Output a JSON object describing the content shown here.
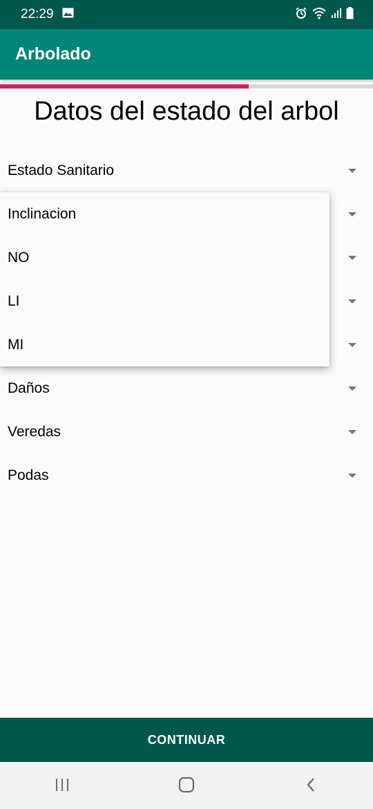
{
  "status_bar": {
    "time": "22:29",
    "icons": [
      "image-icon",
      "alarm-icon",
      "wifi-icon",
      "signal-icon",
      "battery-icon"
    ]
  },
  "app_bar": {
    "title": "Arbolado"
  },
  "progress": {
    "fraction": 0.667,
    "color": "#d81b60"
  },
  "page": {
    "title": "Datos del estado del arbol"
  },
  "spinners": [
    {
      "label": "Estado Sanitario"
    },
    {
      "label": ""
    },
    {
      "label": ""
    },
    {
      "label": ""
    },
    {
      "label": ""
    },
    {
      "label": "Daños"
    },
    {
      "label": "Veredas"
    },
    {
      "label": "Podas"
    }
  ],
  "dropdown": {
    "options": [
      "Inclinacion",
      "NO",
      "LI",
      "MI"
    ]
  },
  "continue_button": {
    "label": "CONTINUAR"
  },
  "nav_bar": {
    "buttons": [
      "recents-icon",
      "home-icon",
      "back-icon"
    ]
  },
  "colors": {
    "status_bar": "#00574b",
    "app_bar": "#008577",
    "accent": "#d81b60",
    "button": "#00574b"
  }
}
